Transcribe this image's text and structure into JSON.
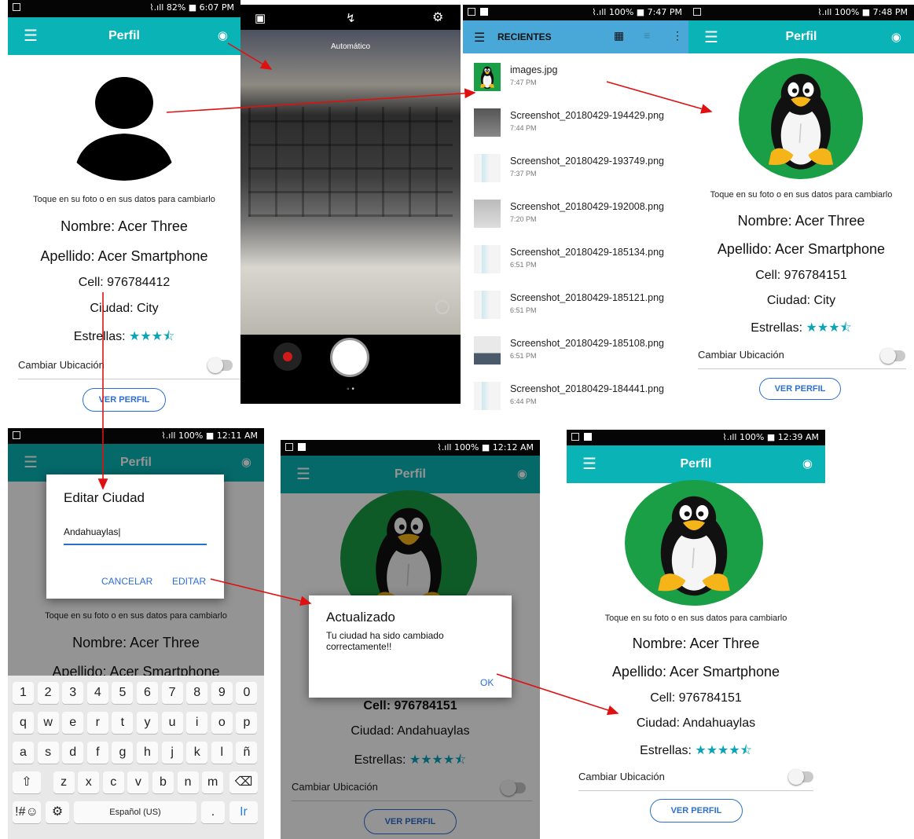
{
  "colors": {
    "teal": "#0ab3b6",
    "arrow": "#e01010",
    "link": "#2f6fcf",
    "star": "#0aa3b8"
  },
  "screen1": {
    "status": "⌇.ıll 82% ■ 6:07 PM",
    "title": "Perfil",
    "hint": "Toque en su foto o en sus datos para cambiarlo",
    "nombre": "Nombre: Acer Three",
    "apellido": "Apellido: Acer Smartphone",
    "cell": "Cell: 976784412",
    "ciudad": "Ciudad: City",
    "estrellas": "Estrellas:",
    "stars": "★★★⯪",
    "ubicacion": "Cambiar Ubicación",
    "ver_perfil": "VER PERFIL"
  },
  "camera": {
    "mode": "Automático",
    "dots": "◦ •"
  },
  "files": {
    "status": "⌇.ıll 100% ■ 7:47 PM",
    "header": "RECIENTES",
    "items": [
      {
        "name": "images.jpg",
        "time": "7:47 PM"
      },
      {
        "name": "Screenshot_20180429-194429.png",
        "time": "7:44 PM"
      },
      {
        "name": "Screenshot_20180429-193749.png",
        "time": "7:37 PM"
      },
      {
        "name": "Screenshot_20180429-192008.png",
        "time": "7:20 PM"
      },
      {
        "name": "Screenshot_20180429-185134.png",
        "time": "6:51 PM"
      },
      {
        "name": "Screenshot_20180429-185121.png",
        "time": "6:51 PM"
      },
      {
        "name": "Screenshot_20180429-185108.png",
        "time": "6:51 PM"
      },
      {
        "name": "Screenshot_20180429-184441.png",
        "time": "6:44 PM"
      }
    ]
  },
  "screen2": {
    "status": "⌇.ıll 100% ■ 7:48 PM",
    "title": "Perfil",
    "hint": "Toque en su foto o en sus datos para cambiarlo",
    "nombre": "Nombre: Acer Three",
    "apellido": "Apellido: Acer Smartphone",
    "cell": "Cell: 976784151",
    "ciudad": "Ciudad: City",
    "estrellas": "Estrellas:",
    "stars": "★★★⯪",
    "ubicacion": "Cambiar Ubicación",
    "ver_perfil": "VER PERFIL"
  },
  "screen3": {
    "status": "⌇.ıll 100% ■ 12:11 AM",
    "title": "Perfil",
    "dialog_title": "Editar Ciudad",
    "input_value": "Andahuaylas",
    "cancel": "CANCELAR",
    "edit": "EDITAR",
    "hint": "Toque en su foto o en sus datos para cambiarlo",
    "nombre": "Nombre: Acer Three",
    "apellido": "Apellido: Acer Smartphone",
    "keyboard": {
      "row1": [
        "1",
        "2",
        "3",
        "4",
        "5",
        "6",
        "7",
        "8",
        "9",
        "0"
      ],
      "row2": [
        "q",
        "w",
        "e",
        "r",
        "t",
        "y",
        "u",
        "i",
        "o",
        "p"
      ],
      "row3": [
        "a",
        "s",
        "d",
        "f",
        "g",
        "h",
        "j",
        "k",
        "l",
        "ñ"
      ],
      "row4": [
        "⇧",
        "z",
        "x",
        "c",
        "v",
        "b",
        "n",
        "m",
        "⌫"
      ],
      "symbols": "!#☺",
      "settings": "⚙",
      "space": "Español (US)",
      "period": ".",
      "go": "Ir"
    }
  },
  "screen4": {
    "status": "⌇.ıll 100% ■ 12:12 AM",
    "title": "Perfil",
    "dialog_title": "Actualizado",
    "dialog_msg": "Tu ciudad ha sido cambiado correctamente!!",
    "ok": "OK",
    "cell": "Cell: 976784151",
    "ciudad": "Ciudad: Andahuaylas",
    "estrellas": "Estrellas:",
    "stars": "★★★★⯪",
    "ubicacion": "Cambiar Ubicación",
    "ver_perfil": "VER PERFIL"
  },
  "screen5": {
    "status": "⌇.ıll 100% ■ 12:39 AM",
    "title": "Perfil",
    "hint": "Toque en su foto o en sus datos para cambiarlo",
    "nombre": "Nombre: Acer Three",
    "apellido": "Apellido: Acer Smartphone",
    "cell": "Cell: 976784151",
    "ciudad": "Ciudad: Andahuaylas",
    "estrellas": "Estrellas:",
    "stars": "★★★★⯪",
    "ubicacion": "Cambiar Ubicación",
    "ver_perfil": "VER PERFIL"
  }
}
